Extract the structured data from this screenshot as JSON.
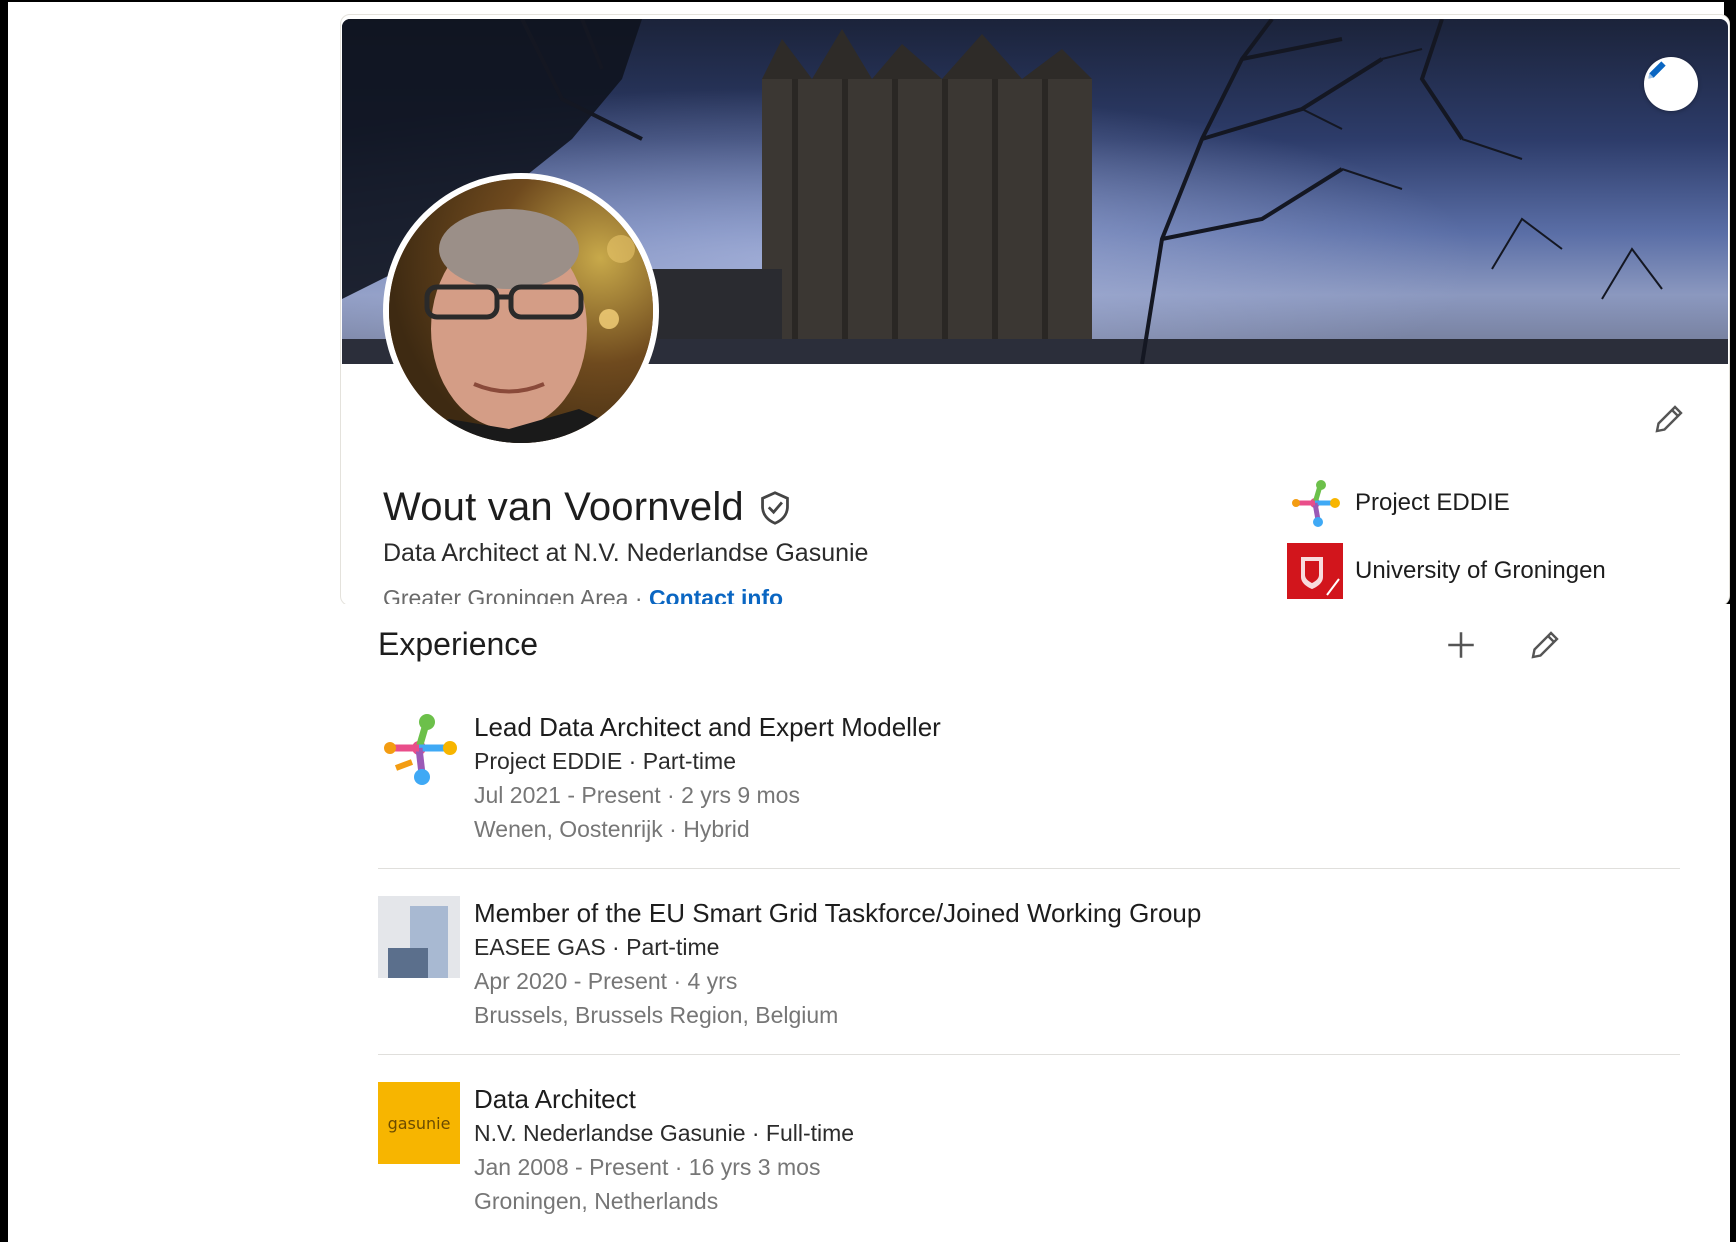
{
  "profile": {
    "name": "Wout van Voornveld",
    "headline": "Data Architect at N.V. Nederlandse Gasunie",
    "location": "Greater Groningen Area",
    "separator": "·",
    "contact_label": "Contact info",
    "verified_icon": "shield-check-icon",
    "organizations": [
      {
        "name": "Project EDDIE",
        "logo": "project-eddie-logo"
      },
      {
        "name": "University of Groningen",
        "logo": "university-of-groningen-logo"
      }
    ]
  },
  "experience": {
    "title": "Experience",
    "items": [
      {
        "role": "Lead Data Architect and Expert Modeller",
        "company": "Project EDDIE · Part-time",
        "dates": "Jul 2021 - Present · 2 yrs 9 mos",
        "location": "Wenen, Oostenrijk · Hybrid"
      },
      {
        "role": "Member of the EU Smart Grid Taskforce/Joined Working Group",
        "company": "EASEE GAS · Part-time",
        "dates": "Apr 2020 - Present · 4 yrs",
        "location": "Brussels, Brussels Region, Belgium"
      },
      {
        "role": "Data Architect",
        "company": "N.V. Nederlandse Gasunie · Full-time",
        "dates": "Jan 2008 - Present · 16 yrs 3 mos",
        "location": "Groningen, Netherlands",
        "logo_text": "gasunie"
      }
    ]
  },
  "colors": {
    "link": "#0a66c2",
    "gasunie_yellow": "#f7b500",
    "groningen_red": "#d2151c"
  }
}
